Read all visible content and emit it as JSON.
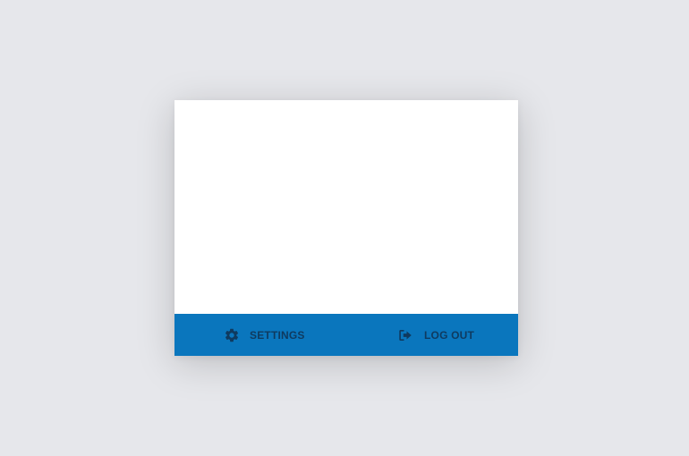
{
  "footer": {
    "settings_label": "SETTINGS",
    "settings_icon": "gear-icon",
    "logout_label": "LOG OUT",
    "logout_icon": "logout-icon"
  },
  "colors": {
    "background": "#e6e7eb",
    "card": "#ffffff",
    "footer_bar": "#0a76bd",
    "footer_text": "#0f3a5f"
  }
}
